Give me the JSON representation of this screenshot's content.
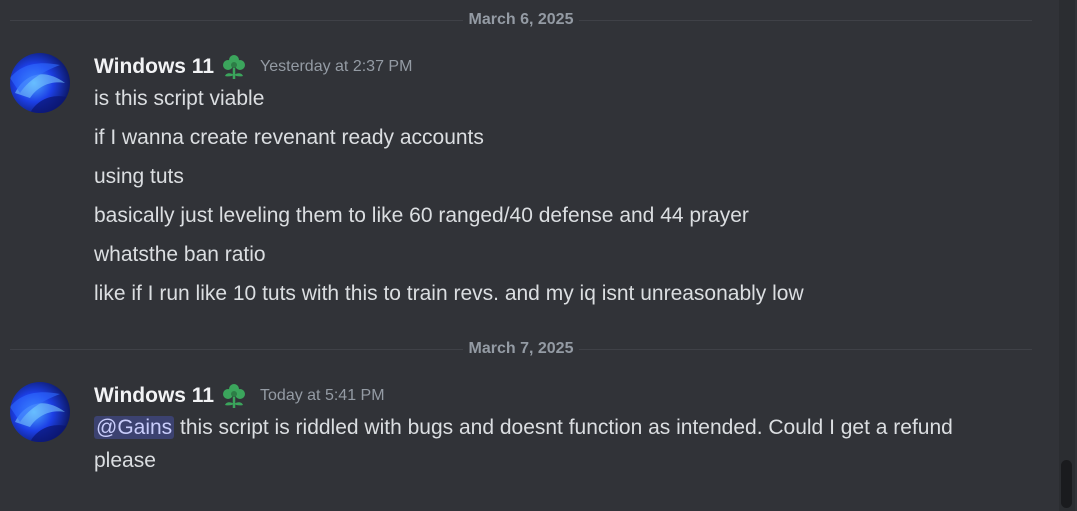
{
  "dividers": [
    "March 6, 2025",
    "March 7, 2025"
  ],
  "messages": [
    {
      "username": "Windows 11",
      "timestamp": "Yesterday at 2:37 PM",
      "lines": [
        "is this script viable",
        "if I wanna create revenant ready accounts",
        "using tuts",
        "basically just leveling them to like 60 ranged/40 defense and 44 prayer",
        "whatsthe ban ratio",
        "like if I run like 10 tuts with this to train revs. and my iq isnt unreasonably low"
      ]
    },
    {
      "username": "Windows 11",
      "timestamp": "Today at 5:41 PM",
      "mention": "@Gains",
      "text": " this script is riddled with bugs and doesnt function as intended. Could I get a refund please"
    }
  ],
  "icons": {
    "avatar": "avatar-image",
    "role": "flower-icon",
    "role_color": "#3ba55c"
  },
  "colors": {
    "background": "#313338",
    "mention_bg": "#3c4270",
    "mention_text": "#c9cdfb"
  }
}
